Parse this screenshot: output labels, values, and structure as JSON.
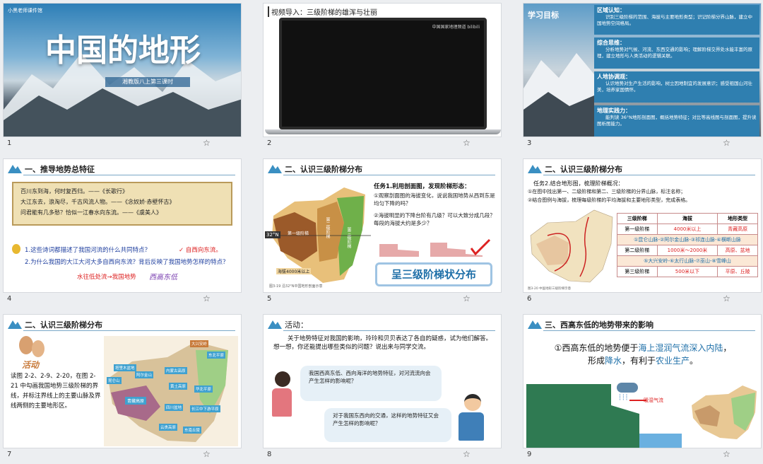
{
  "slides": [
    {
      "num": "1",
      "brand": "小黑老师课件馆",
      "title": "中国的地形",
      "subtitle": "湘教版八上第三课时"
    },
    {
      "num": "2",
      "title": "视频导入：三级阶梯的雄浑与壮丽",
      "video_brand": "中国国家地理频道 bilibili"
    },
    {
      "num": "3",
      "label": "学习目标",
      "goals": [
        {
          "h": "区域认知：",
          "t": "识别三级阶梯的范围、海拔与主要地形类型；识记阶梯分界山脉，建立中国地势空间格局。"
        },
        {
          "h": "综合思维：",
          "t": "分析地势对气候、河流、东西交通的影响；理解阶梯交界处水能丰富的原理，建立地形与人类活动的逻辑关联。"
        },
        {
          "h": "人地协调观：",
          "t": "认识地势对生产生活的影响，树立因地制宜的发展意识；感受祖国山河壮美，培养家国情怀。"
        },
        {
          "h": "地理实践力：",
          "t": "能判读 36°N地形剖面图，概括地势特征；对比等高线图与剖面图，提升读图析图能力。"
        }
      ]
    },
    {
      "num": "4",
      "title": "一、推导地势总特征",
      "poems": [
        "百川东到海，何时复西归。——《长歌行》",
        "大江东去，浪淘尽，千古风流人物。——《念奴娇·赤壁怀古》",
        "问君能有几多愁？恰似一江春水向东流。——《虞美人》"
      ],
      "q1": "1.这些诗词都描述了我国河流的什么共同特点？",
      "a1": "✓ 自西向东流。",
      "q2": "2.为什么我国的大江大河大多自西向东流？背后反映了我国地势怎样的特点？",
      "a2": "水往低处流→我国地势",
      "a2b": "西高东低"
    },
    {
      "num": "5",
      "title": "二、认识三级阶梯分布",
      "lat": "32°N",
      "labels": [
        "第一级阶梯",
        "第二级阶梯",
        "第三级阶梯",
        "海拔4000米以上"
      ],
      "task": "任务1.利用剖面图，发现阶梯形态：",
      "p1": "①观察剖面图的海拔变化，说说我国地势从西到东是均匀下降的吗？",
      "p2": "②海拔明显的下降台阶有几级？可以大致分成几段？每段的海拔大约是多少？",
      "banner": "呈三级阶梯状分布",
      "caption": "图3-19 沿32°N中国地形剖面示意"
    },
    {
      "num": "6",
      "title": "二、认识三级阶梯分布",
      "task": "任务2.结合地形图，梳理阶梯概况：",
      "p1": "①在图中找出第一、二级阶梯和第二、三级阶梯的分界山脉，标注名称；",
      "p2": "②结合图例与海拔，梳理每级阶梯的平均海拔和主要地形类型，完成表格。",
      "table": {
        "h": [
          "三级阶梯",
          "海拔",
          "地形类型"
        ],
        "rows": [
          [
            "第一级阶梯",
            "4000米以上",
            "青藏高原"
          ],
          [
            "第二级阶梯",
            "1000米～2000米",
            "高原、盆地"
          ],
          [
            "第三级阶梯",
            "500米以下",
            "平原、丘陵"
          ]
        ],
        "mid1": "①昆仑山脉-②阿尔金山脉-③祁连山脉-④横断山脉",
        "mid2": "⑤大兴安岭-⑥太行山脉-⑦巫山-⑧雪峰山"
      },
      "caption": "图3-20 中国地形三级阶梯示意"
    },
    {
      "num": "7",
      "title": "二、认识三级阶梯分布",
      "activity": "活动",
      "text": "读图 2-2、2-9、2-20，在图 2-21 中勾画我国地势三级阶梯的界线，并标注界线上的主要山脉及界线两侧的主要地形区。",
      "regions": [
        "塔里木盆地",
        "昆仑山",
        "阿尔金山",
        "内蒙古高原",
        "东北平原",
        "华北平原",
        "青藏高原",
        "黄土高原",
        "四川盆地",
        "长江中下游平原",
        "云贵高原",
        "东南丘陵",
        "大兴安岭"
      ]
    },
    {
      "num": "8",
      "title": "活动：",
      "text": "关于地势特征对我国的影响，玲玲和贝贝表达了各自的疑惑，试为他们解答。想一想，你还能提出哪些类似的问题？说出来与同学交流。",
      "b1": "我国西高东低、西向海洋的地势特征，对河流流向会产生怎样的影响呢？",
      "b2": "对于我国东西向的交通，这样的地势特征又会产生怎样的影响呢？"
    },
    {
      "num": "9",
      "title": "三、西高东低的地势带来的影响",
      "l1a": "①西高东低的地势便于",
      "l1b": "海上湿润气流深入内陆",
      "l1c": "，",
      "l2a": "形成",
      "l2b": "降水",
      "l2c": "，有利于",
      "l2d": "农业生产",
      "l2e": "。",
      "wind": "暖湿气流"
    }
  ],
  "colors": {
    "accent": "#1e6fa8",
    "red": "#d22",
    "goalbg": "#2f7fb0"
  }
}
